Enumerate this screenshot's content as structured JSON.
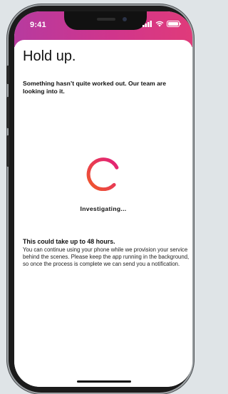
{
  "status_bar": {
    "time": "9:41",
    "gradient_colors": [
      "#b73a9f",
      "#d0358c",
      "#e03b7a"
    ]
  },
  "page": {
    "title": "Hold up.",
    "subtitle": "Something hasn’t quite worked out. Our team are looking into it.",
    "status": "Investigating...",
    "notice_title": "This could take up to 48 hours.",
    "notice_body": "You can continue using your phone while we provision your service behind the scenes. Please keep the app running in the background, so once the process is complete we can send you a notification."
  },
  "icons": {
    "signal": "cellular-signal-icon",
    "wifi": "wifi-icon",
    "battery": "battery-icon",
    "spinner": "loading-spinner-icon"
  },
  "colors": {
    "spinner_start": "#f05a28",
    "spinner_end": "#e11f7b"
  }
}
